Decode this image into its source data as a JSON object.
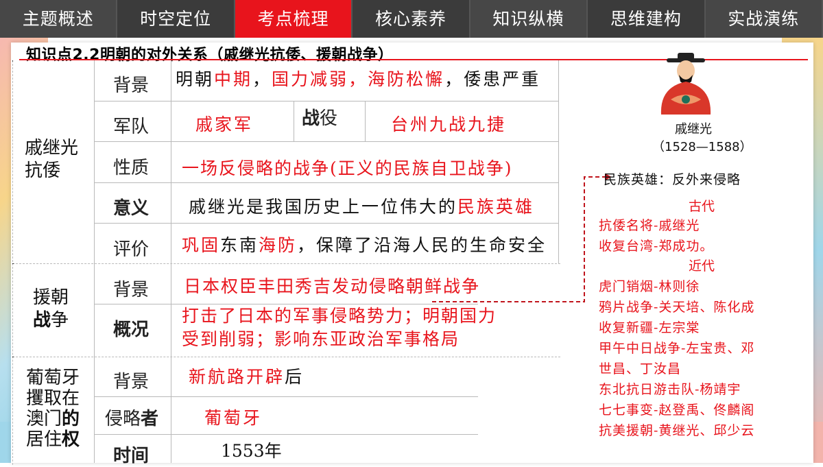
{
  "nav": {
    "tabs": [
      {
        "label": "主题概述"
      },
      {
        "label": "时空定位"
      },
      {
        "label": "考点梳理"
      },
      {
        "label": "核心素养"
      },
      {
        "label": "知识纵横"
      },
      {
        "label": "思维建构"
      },
      {
        "label": "实战演练"
      }
    ],
    "active_index": 2
  },
  "title": "知识点2.2明朝的对外关系（戚继光抗倭、援朝战争）",
  "table": {
    "group1": {
      "name": "戚继光抗倭",
      "background_label": "背景",
      "background_parts": [
        "明朝",
        "中期",
        "，",
        "国力减弱，",
        "海防松懈",
        "，倭患严重"
      ],
      "army_label": "军队",
      "army_value": "戚家军",
      "battle_label_bold": "战",
      "battle_label_rest": "役",
      "battle_value": "台州九战九捷",
      "nature_label": "性质",
      "nature_value": "一场反侵略的战争(正义的民族自卫战争)",
      "meaning_label": "意义",
      "meaning_prefix": "戚继光是我国历史上一位伟大的",
      "meaning_red": "民族英雄",
      "evaluation_label": "评价",
      "evaluation_parts": [
        "巩固",
        "东南",
        "海防",
        "，保障了沿海人民的生命安全"
      ]
    },
    "group2": {
      "name_line1": "援朝",
      "name_bold": "战",
      "name_rest": "争",
      "background_label": "背景",
      "background_value": "日本权臣丰田秀吉发动侵略朝鲜战争",
      "overview_label": "概况",
      "overview_line1": "打击了日本的军事侵略势力；明朝国力",
      "overview_line2": "受到削弱；影响东亚政治军事格局"
    },
    "group3": {
      "name_line1": "葡萄牙",
      "name_line2": "攫取在",
      "name_line3_a": "澳门",
      "name_line3_b": "的",
      "name_line4_a": "居住",
      "name_line4_b": "权",
      "background_label": "背景",
      "background_red": "新航路开辟",
      "background_black": "后",
      "invader_label_a": "侵略",
      "invader_label_b": "者",
      "invader_value": "葡萄牙",
      "time_label": "时间",
      "time_value": "1553年"
    }
  },
  "portrait": {
    "name": "戚继光",
    "dates": "（1528—1588）"
  },
  "heroes": {
    "title": "民族英雄：反外来侵略",
    "ancient_label": "古代",
    "ancient": [
      "抗倭名将-戚继光",
      "收复台湾-郑成功。"
    ],
    "modern_label": "近代",
    "modern": [
      "虎门销烟-林则徐",
      "鸦片战争-关天培、陈化成",
      "收复新疆-左宗棠",
      "甲午中日战争-左宝贵、邓",
      "世昌、丁汝昌",
      "东北抗日游击队-杨靖宇",
      "七七事变-赵登禹、佟麟阁",
      "抗美援朝-黄继光、邱少云"
    ]
  },
  "colors": {
    "accent_red": "#e8141c",
    "nav_bg": "#3b3b3b"
  }
}
